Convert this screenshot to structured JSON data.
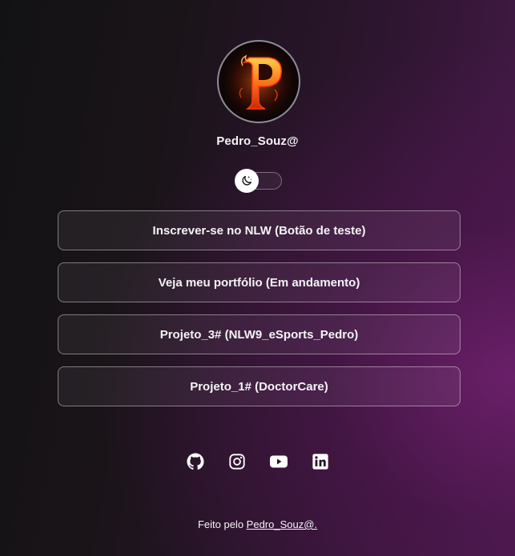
{
  "profile": {
    "avatar_icon": "flaming-letter-p-logo",
    "username": "Pedro_Souz@"
  },
  "theme_switch": {
    "icon": "moon-stars-icon",
    "state": "dark"
  },
  "links": [
    {
      "label": "Inscrever-se no NLW (Botão de teste)"
    },
    {
      "label": "Veja meu portfólio (Em andamento)"
    },
    {
      "label": "Projeto_3# (NLW9_eSports_Pedro)"
    },
    {
      "label": "Projeto_1# (DoctorCare)"
    }
  ],
  "socials": [
    {
      "icon": "github-icon"
    },
    {
      "icon": "instagram-icon"
    },
    {
      "icon": "youtube-icon"
    },
    {
      "icon": "linkedin-icon"
    }
  ],
  "footer": {
    "prefix": "Feito pelo ",
    "link_text": "Pedro_Souz@."
  },
  "colors": {
    "text": "#f4f4f5",
    "background_dark": "#121214",
    "background_accent": "#4a1a4d"
  }
}
